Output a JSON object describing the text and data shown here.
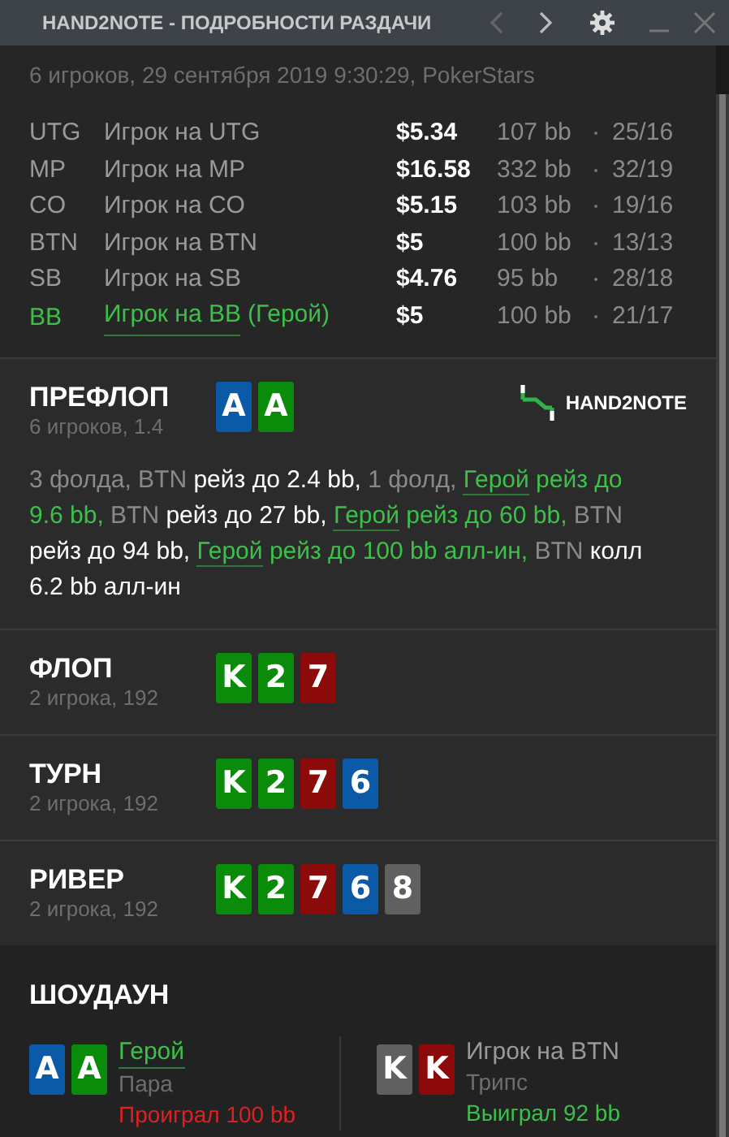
{
  "window": {
    "title": "HAND2NOTE - ПОДРОБНОСТИ РАЗДАЧИ"
  },
  "summary": "6 игроков, 29 сентября 2019 9:30:29, PokerStars",
  "players": [
    {
      "position": "UTG",
      "name": "Игрок на UTG",
      "stack": "$5.34",
      "bb": "107 bb",
      "stats": "25/16",
      "hero": false
    },
    {
      "position": "MP",
      "name": "Игрок на MP",
      "stack": "$16.58",
      "bb": "332 bb",
      "stats": "32/19",
      "hero": false
    },
    {
      "position": "CO",
      "name": "Игрок на CO",
      "stack": "$5.15",
      "bb": "103 bb",
      "stats": "19/16",
      "hero": false
    },
    {
      "position": "BTN",
      "name": "Игрок на BTN",
      "stack": "$5",
      "bb": "100 bb",
      "stats": "13/13",
      "hero": false
    },
    {
      "position": "SB",
      "name": "Игрок на SB",
      "stack": "$4.76",
      "bb": "95 bb",
      "stats": "28/18",
      "hero": false
    },
    {
      "position": "BB",
      "name": "Игрок на BB",
      "name_suffix": "(Герой)",
      "stack": "$5",
      "bb": "100 bb",
      "stats": "21/17",
      "hero": true
    }
  ],
  "streets": [
    {
      "title": "ПРЕФЛОП",
      "subtitle": "6 игроков, 1.4",
      "logo": "HAND2NOTE",
      "cards": [
        {
          "rank": "A",
          "color": "#0a5aa8"
        },
        {
          "rank": "A",
          "color": "#0a8c0a"
        }
      ],
      "actions": [
        {
          "kind": "muted",
          "text": "3 фолда, BTN "
        },
        {
          "kind": "plain",
          "text": "рейз до 2.4 bb, "
        },
        {
          "kind": "muted",
          "text": "1 фолд, "
        },
        {
          "kind": "hero_link",
          "text": "Герой"
        },
        {
          "kind": "hero",
          "text": " рейз до 9.6 bb, "
        },
        {
          "kind": "muted",
          "text": "BTN "
        },
        {
          "kind": "plain",
          "text": "рейз до 27 bb, "
        },
        {
          "kind": "hero_link",
          "text": "Герой"
        },
        {
          "kind": "hero",
          "text": " рейз до 60 bb, "
        },
        {
          "kind": "muted",
          "text": "BTN "
        },
        {
          "kind": "plain",
          "text": "рейз до 94 bb, "
        },
        {
          "kind": "hero_link",
          "text": "Герой"
        },
        {
          "kind": "hero",
          "text": " рейз до 100 bb алл-ин, "
        },
        {
          "kind": "muted",
          "text": "BTN "
        },
        {
          "kind": "plain",
          "text": "колл 6.2 bb алл-ин"
        }
      ]
    },
    {
      "title": "ФЛОП",
      "subtitle": "2 игрока, 192",
      "cards": [
        {
          "rank": "K",
          "color": "#0a8c0a"
        },
        {
          "rank": "2",
          "color": "#0a8c0a"
        },
        {
          "rank": "7",
          "color": "#8c0a0a"
        }
      ]
    },
    {
      "title": "ТУРН",
      "subtitle": "2 игрока, 192",
      "cards": [
        {
          "rank": "K",
          "color": "#0a8c0a"
        },
        {
          "rank": "2",
          "color": "#0a8c0a"
        },
        {
          "rank": "7",
          "color": "#8c0a0a"
        },
        {
          "rank": "6",
          "color": "#0a5aa8"
        }
      ]
    },
    {
      "title": "РИВЕР",
      "subtitle": "2 игрока, 192",
      "cards": [
        {
          "rank": "K",
          "color": "#0a8c0a"
        },
        {
          "rank": "2",
          "color": "#0a8c0a"
        },
        {
          "rank": "7",
          "color": "#8c0a0a"
        },
        {
          "rank": "6",
          "color": "#0a5aa8"
        },
        {
          "rank": "8",
          "color": "#606060"
        }
      ]
    }
  ],
  "showdown": {
    "title": "ШОУДАУН",
    "hands": [
      {
        "name": "Герой",
        "hero": true,
        "hand": "Пара",
        "result": "Проиграл 100 bb",
        "won": false,
        "cards": [
          {
            "rank": "A",
            "color": "#0a5aa8"
          },
          {
            "rank": "A",
            "color": "#0a8c0a"
          }
        ]
      },
      {
        "name": "Игрок на BTN",
        "hero": false,
        "hand": "Трипс",
        "result": "Выиграл 92 bb",
        "won": true,
        "cards": [
          {
            "rank": "K",
            "color": "#606060"
          },
          {
            "rank": "K",
            "color": "#8c0a0a"
          }
        ]
      }
    ]
  }
}
